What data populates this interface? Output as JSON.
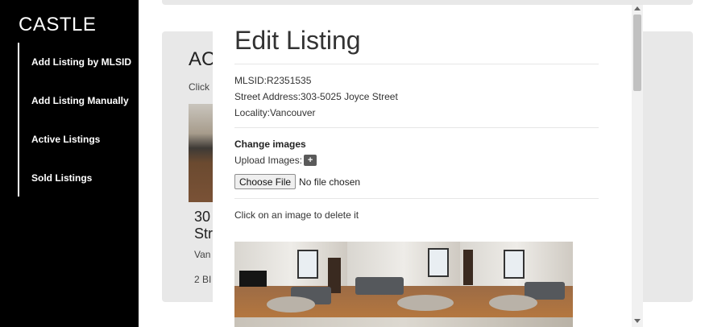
{
  "sidebar": {
    "brand": "CASTLE",
    "items": [
      {
        "label": "Add Listing by MLSID"
      },
      {
        "label": "Add Listing Manually"
      },
      {
        "label": "Active Listings"
      },
      {
        "label": "Sold Listings"
      }
    ]
  },
  "background": {
    "heading": "AC",
    "subtext": "Click",
    "listing_title": "30\nStr",
    "listing_locality": "Van",
    "listing_beds": "2 BI"
  },
  "modal": {
    "title": "Edit Listing",
    "mlsid": "MLSID:R2351535",
    "street_address": "Street Address:303-5025 Joyce Street",
    "locality": "Locality:Vancouver",
    "change_images_title": "Change images",
    "upload_images_label": "Upload Images:",
    "upload_plus": "+",
    "choose_file_label": "Choose File",
    "file_status": "No file chosen",
    "delete_hint": "Click on an image to delete it"
  },
  "colors": {
    "sidebar_bg": "#000000",
    "card_bg": "#e8e8e8",
    "modal_bg": "#ffffff"
  }
}
